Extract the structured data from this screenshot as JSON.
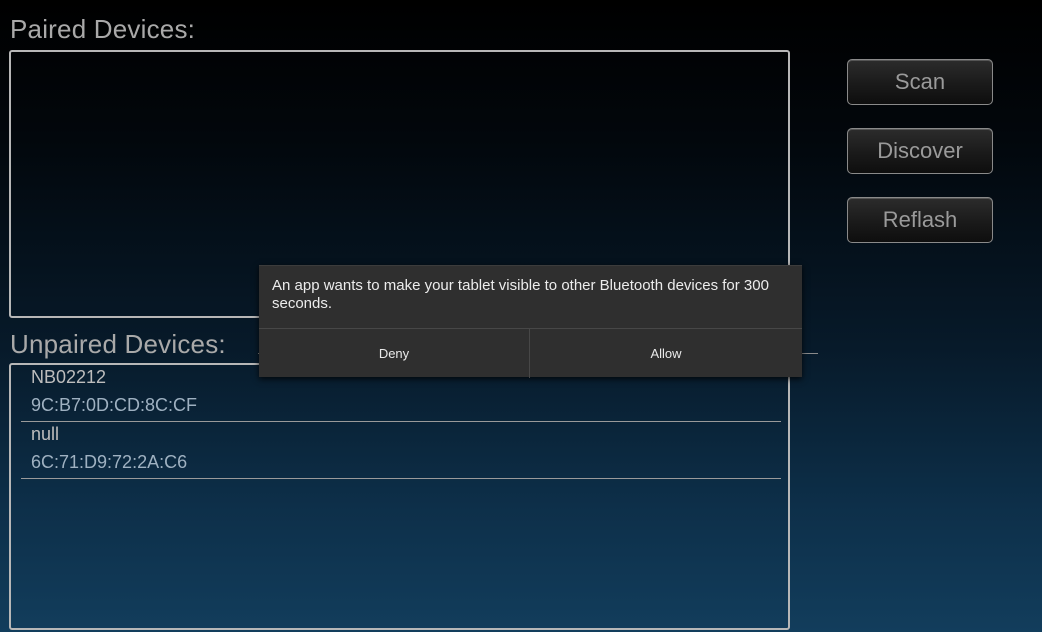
{
  "paired": {
    "title": "Paired Devices:"
  },
  "unpaired": {
    "title": "Unpaired Devices:",
    "devices": [
      {
        "name": "NB02212",
        "mac": "9C:B7:0D:CD:8C:CF"
      },
      {
        "name": "null",
        "mac": "6C:71:D9:72:2A:C6"
      }
    ]
  },
  "actions": {
    "scan": "Scan",
    "discover": "Discover",
    "reflash": "Reflash"
  },
  "dialog": {
    "message": "An app wants to make your tablet visible to other Bluetooth devices for 300 seconds.",
    "deny": "Deny",
    "allow": "Allow"
  }
}
